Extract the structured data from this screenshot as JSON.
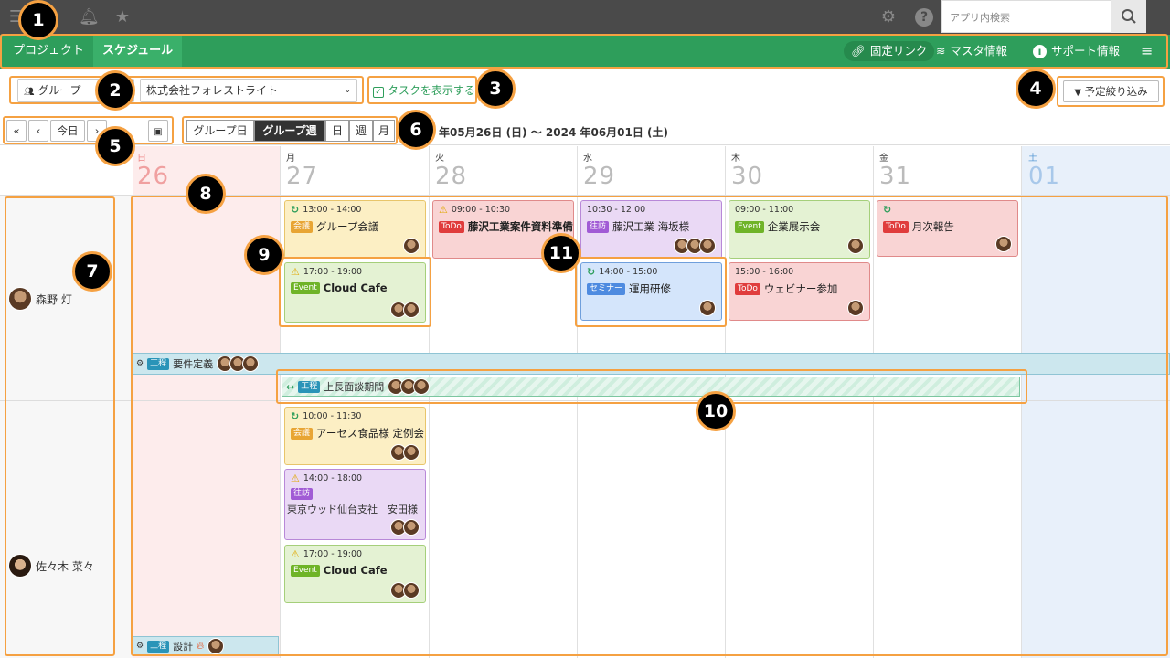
{
  "topbar": {
    "search_placeholder": "アプリ内検索"
  },
  "nav": {
    "tabs": [
      "プロジェクト",
      "スケジュール"
    ],
    "fixed_link": "固定リンク",
    "master_info": "マスタ情報",
    "support_info": "サポート情報"
  },
  "filters": {
    "group_label": "グループ",
    "company": "株式会社フォレストライト",
    "show_tasks": "タスクを表示する",
    "narrow": "予定絞り込み"
  },
  "toolbar": {
    "first": "«",
    "prev": "‹",
    "today": "今日",
    "next": "›",
    "views": [
      "グループ日",
      "グループ週",
      "日",
      "週",
      "月"
    ],
    "range_text": "年05月26日 (日) ～ 2024 年06月01日 (土)"
  },
  "days": [
    {
      "wd": "日",
      "num": "26"
    },
    {
      "wd": "月",
      "num": "27"
    },
    {
      "wd": "火",
      "num": "28"
    },
    {
      "wd": "水",
      "num": "29"
    },
    {
      "wd": "木",
      "num": "30"
    },
    {
      "wd": "金",
      "num": "31"
    },
    {
      "wd": "土",
      "num": "01"
    }
  ],
  "users": [
    "森野 灯",
    "佐々木 菜々"
  ],
  "events": {
    "e1": {
      "time": "13:00 - 14:00",
      "tag": "会議",
      "title": "グループ会議"
    },
    "e2": {
      "time": "17:00 - 19:00",
      "tag": "Event",
      "title": "Cloud Cafe"
    },
    "e3": {
      "time": "09:00 - 10:30",
      "tag": "ToDo",
      "title": "藤沢工業案件資料準備"
    },
    "e4": {
      "time": "10:30 - 12:00",
      "tag": "往訪",
      "title": "藤沢工業 海坂様"
    },
    "e5": {
      "time": "14:00 - 15:00",
      "tag": "セミナー",
      "title": "運用研修"
    },
    "e6": {
      "time": "09:00 - 11:00",
      "tag": "Event",
      "title": "企業展示会"
    },
    "e7": {
      "time": "15:00 - 16:00",
      "tag": "ToDo",
      "title": "ウェビナー参加"
    },
    "e8": {
      "time": "",
      "tag": "ToDo",
      "title": "月次報告"
    },
    "e9": {
      "time": "10:00 - 11:30",
      "tag": "会議",
      "title": "アーセス食品様 定例会"
    },
    "e10": {
      "time": "14:00 - 18:00",
      "tag": "往訪",
      "title": "東京ウッド仙台支社　安田様"
    },
    "e11": {
      "time": "17:00 - 19:00",
      "tag": "Event",
      "title": "Cloud Cafe"
    }
  },
  "bars": {
    "b1": {
      "tag": "工程",
      "title": "要件定義"
    },
    "b2": {
      "tag": "工程",
      "title": "上長面談期間"
    },
    "b3": {
      "tag": "工程",
      "title": "設計"
    }
  },
  "annotations": [
    "1",
    "2",
    "3",
    "4",
    "5",
    "6",
    "7",
    "8",
    "9",
    "10",
    "11"
  ]
}
